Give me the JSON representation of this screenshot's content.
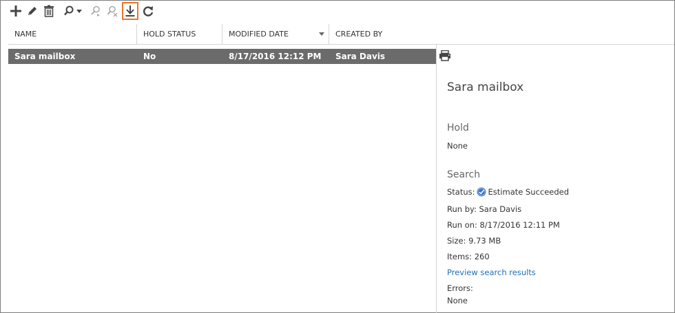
{
  "toolbar": {
    "items": [
      {
        "name": "add",
        "icon": "plus-icon"
      },
      {
        "name": "edit",
        "icon": "pencil-icon"
      },
      {
        "name": "delete",
        "icon": "trash-icon"
      },
      {
        "name": "search",
        "icon": "search-icon"
      },
      {
        "name": "start-search",
        "icon": "start-search-icon"
      },
      {
        "name": "stop-search",
        "icon": "stop-search-icon"
      },
      {
        "name": "export",
        "icon": "download-icon"
      },
      {
        "name": "refresh",
        "icon": "refresh-icon"
      }
    ],
    "highlight_color": "#e8742a"
  },
  "list": {
    "columns": [
      "NAME",
      "HOLD STATUS",
      "MODIFIED DATE",
      "CREATED BY"
    ],
    "sorted_column": "MODIFIED DATE",
    "rows": [
      {
        "name": "Sara mailbox",
        "hold_status": "No",
        "modified_date": "8/17/2016 12:12 PM",
        "created_by": "Sara Davis",
        "selected": true
      }
    ]
  },
  "details": {
    "title": "Sara mailbox",
    "hold_heading": "Hold",
    "hold_value": "None",
    "search_heading": "Search",
    "status_label": "Status:",
    "status_value": "Estimate Succeeded",
    "run_by": "Run by: Sara Davis",
    "run_on": "Run on: 8/17/2016 12:11 PM",
    "size": "Size: 9.73 MB",
    "items": "Items: 260",
    "preview_link": "Preview search results",
    "errors_label": "Errors:",
    "errors_value": "None"
  },
  "colors": {
    "selected_row": "#6b6b6b",
    "link": "#1f6fb8",
    "status_icon": "#3b73c4"
  }
}
